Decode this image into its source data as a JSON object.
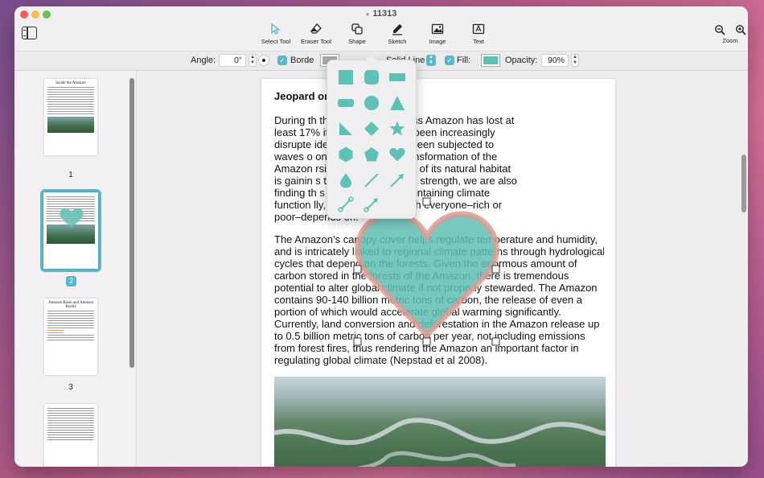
{
  "window": {
    "title": "11313"
  },
  "toolbar": {
    "tools": [
      {
        "label": "Select Tool"
      },
      {
        "label": "Eraser Tool"
      },
      {
        "label": "Shape"
      },
      {
        "label": "Sketch"
      },
      {
        "label": "Image"
      },
      {
        "label": "Text"
      }
    ],
    "zoom_label": "Zoom"
  },
  "options": {
    "angle_label": "Angle:",
    "angle_value": "0°",
    "border_label": "Borde",
    "line_style": "Solid Line",
    "fill_label": "Fill:",
    "opacity_label": "Opacity:",
    "opacity_value": "90%"
  },
  "colors": {
    "accent": "#5ab6c8",
    "shape_fill": "#5fc0b4",
    "heart_border": "#dc9b92"
  },
  "thumbnails": {
    "page1": {
      "title": "Inside the Amazon",
      "number": "1"
    },
    "page2": {
      "number": "2"
    },
    "page3": {
      "title": "Amazon Basin and Amazon Biome",
      "number": "3"
    }
  },
  "shape_menu": {
    "icons": [
      "square-icon",
      "rounded-square-icon",
      "rectangle-icon",
      "rounded-rectangle-icon",
      "circle-icon",
      "triangle-icon",
      "right-triangle-icon",
      "diamond-icon",
      "star-icon",
      "hexagon-icon",
      "pentagon-icon",
      "heart-icon",
      "drop-icon",
      "line-icon",
      "arrow-icon",
      "connector-icon",
      "connector-arrow-icon"
    ]
  },
  "document": {
    "title": "Jeopard                           on Earth",
    "para1": [
      "During th                      the seemingly endless Amazon has lost at",
      "least 17%                     its connectivity has been increasingly",
      "disrupte                    idemic species have been subjected to",
      "waves o                   on. The economic transformation of the",
      "Amazon                  rsion and degradation of its natural habitat",
      "is gainin                  s those forces grow in strength, we are also",
      "finding th                 s a critical role in maintaining climate",
      "function                 lly, a contribution which everyone–rich or",
      "poor–depends on."
    ],
    "para2": [
      "The Amazon’s canopy cover helps regulate temperature and humidity,",
      "and is intricately linked to regional climate patterns through hydrological",
      "cycles that depend on the forests. Given the enormous amount of",
      "carbon stored in the forests of the Amazon, there is tremendous",
      "potential to alter global climate if not properly stewarded. The Amazon",
      "contains 90-140 billion metric tons of carbon, the release of even a",
      "portion of which would accelerate global warming significantly.",
      "Currently, land conversion and deforestation in the Amazon release up",
      "to 0.5 billion metric tons of carbon per year, not including emissions",
      "from forest fires, thus rendering the Amazon an important factor in",
      "regulating global climate (Nepstad et al 2008)."
    ]
  }
}
